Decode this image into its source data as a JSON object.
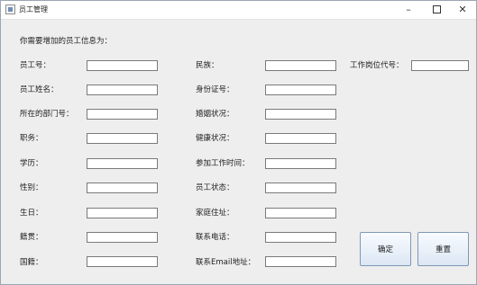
{
  "window": {
    "title": "员工管理",
    "minimize_glyph": "–",
    "close_glyph": "✕"
  },
  "form": {
    "heading": "你需要增加的员工信息为：",
    "col1": [
      {
        "label": "员工号：",
        "value": ""
      },
      {
        "label": "员工姓名：",
        "value": ""
      },
      {
        "label": "所在的部门号：",
        "value": ""
      },
      {
        "label": "职务：",
        "value": ""
      },
      {
        "label": "学历：",
        "value": ""
      },
      {
        "label": "性别：",
        "value": ""
      },
      {
        "label": "生日：",
        "value": ""
      },
      {
        "label": "籍贯：",
        "value": ""
      },
      {
        "label": "国籍：",
        "value": ""
      }
    ],
    "col2": [
      {
        "label": "民族：",
        "value": ""
      },
      {
        "label": "身份证号：",
        "value": ""
      },
      {
        "label": "婚姻状况：",
        "value": ""
      },
      {
        "label": "健康状况：",
        "value": ""
      },
      {
        "label": "参加工作时间：",
        "value": ""
      },
      {
        "label": "员工状态：",
        "value": ""
      },
      {
        "label": "家庭住址：",
        "value": ""
      },
      {
        "label": "联系电话：",
        "value": ""
      },
      {
        "label": "联系Email地址：",
        "value": ""
      }
    ],
    "col3": [
      {
        "label": "工作岗位代号：",
        "value": ""
      }
    ]
  },
  "buttons": {
    "confirm": "确定",
    "reset": "重置"
  }
}
